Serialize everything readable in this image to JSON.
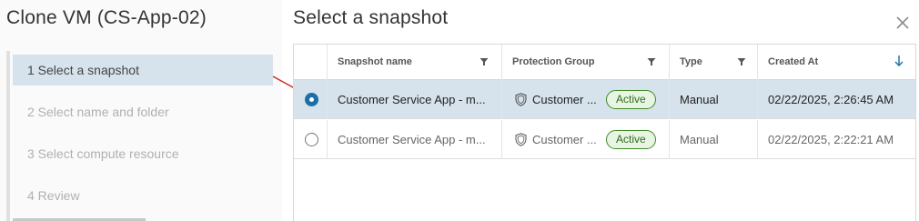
{
  "left": {
    "title": "Clone VM (CS-App-02)",
    "steps": [
      {
        "label": "1  Select a snapshot",
        "active": true
      },
      {
        "label": "2  Select name and folder",
        "active": false
      },
      {
        "label": "3  Select compute resource",
        "active": false
      },
      {
        "label": "4  Review",
        "active": false
      }
    ]
  },
  "main": {
    "title": "Select a snapshot",
    "close_icon": "close-icon"
  },
  "table": {
    "columns": [
      {
        "label": "Snapshot name",
        "icon": "filter-icon"
      },
      {
        "label": "Protection Group",
        "icon": "filter-icon"
      },
      {
        "label": "Type",
        "icon": "filter-icon"
      },
      {
        "label": "Created At",
        "icon": "sort-down-icon"
      }
    ],
    "rows": [
      {
        "selected": true,
        "snapshot": "Customer Service App - m...",
        "group": "Customer ...",
        "status": "Active",
        "type": "Manual",
        "created": "02/22/2025, 2:26:45 AM"
      },
      {
        "selected": false,
        "snapshot": "Customer Service App - m...",
        "group": "Customer ...",
        "status": "Active",
        "type": "Manual",
        "created": "02/22/2025, 2:22:21 AM"
      }
    ]
  },
  "colors": {
    "selection": "#d6e3ec",
    "accent": "#1a6fa3",
    "badge_border": "#3f8a2a",
    "arrow": "#d0281f"
  }
}
